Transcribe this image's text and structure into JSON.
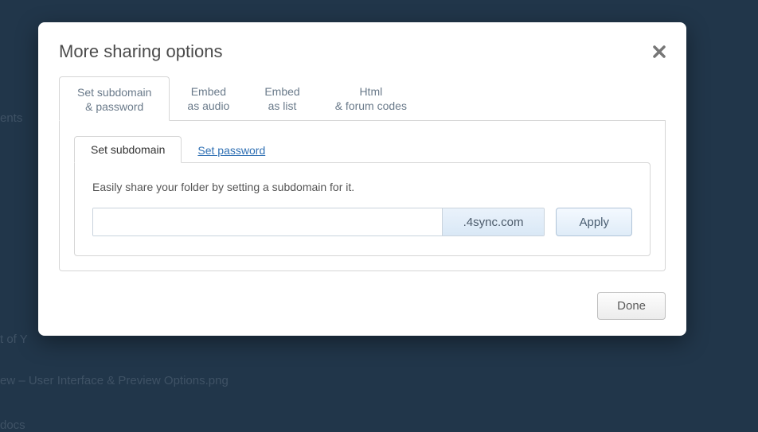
{
  "bg": {
    "t1": "ents",
    "t2": "t of Y",
    "t3": "ew – User Interface & Preview Options.png",
    "t4": "docs"
  },
  "modal": {
    "title": "More sharing options",
    "outerTabs": [
      {
        "line1": "Set subdomain",
        "line2": "& password"
      },
      {
        "line1": "Embed",
        "line2": "as audio"
      },
      {
        "line1": "Embed",
        "line2": "as list"
      },
      {
        "line1": "Html",
        "line2": "& forum codes"
      }
    ],
    "innerTabs": {
      "subdomain": "Set subdomain",
      "password": "Set password"
    },
    "panel": {
      "desc": "Easily share your folder by setting a subdomain for it.",
      "inputValue": "",
      "suffix": ".4sync.com",
      "applyLabel": "Apply"
    },
    "doneLabel": "Done"
  }
}
